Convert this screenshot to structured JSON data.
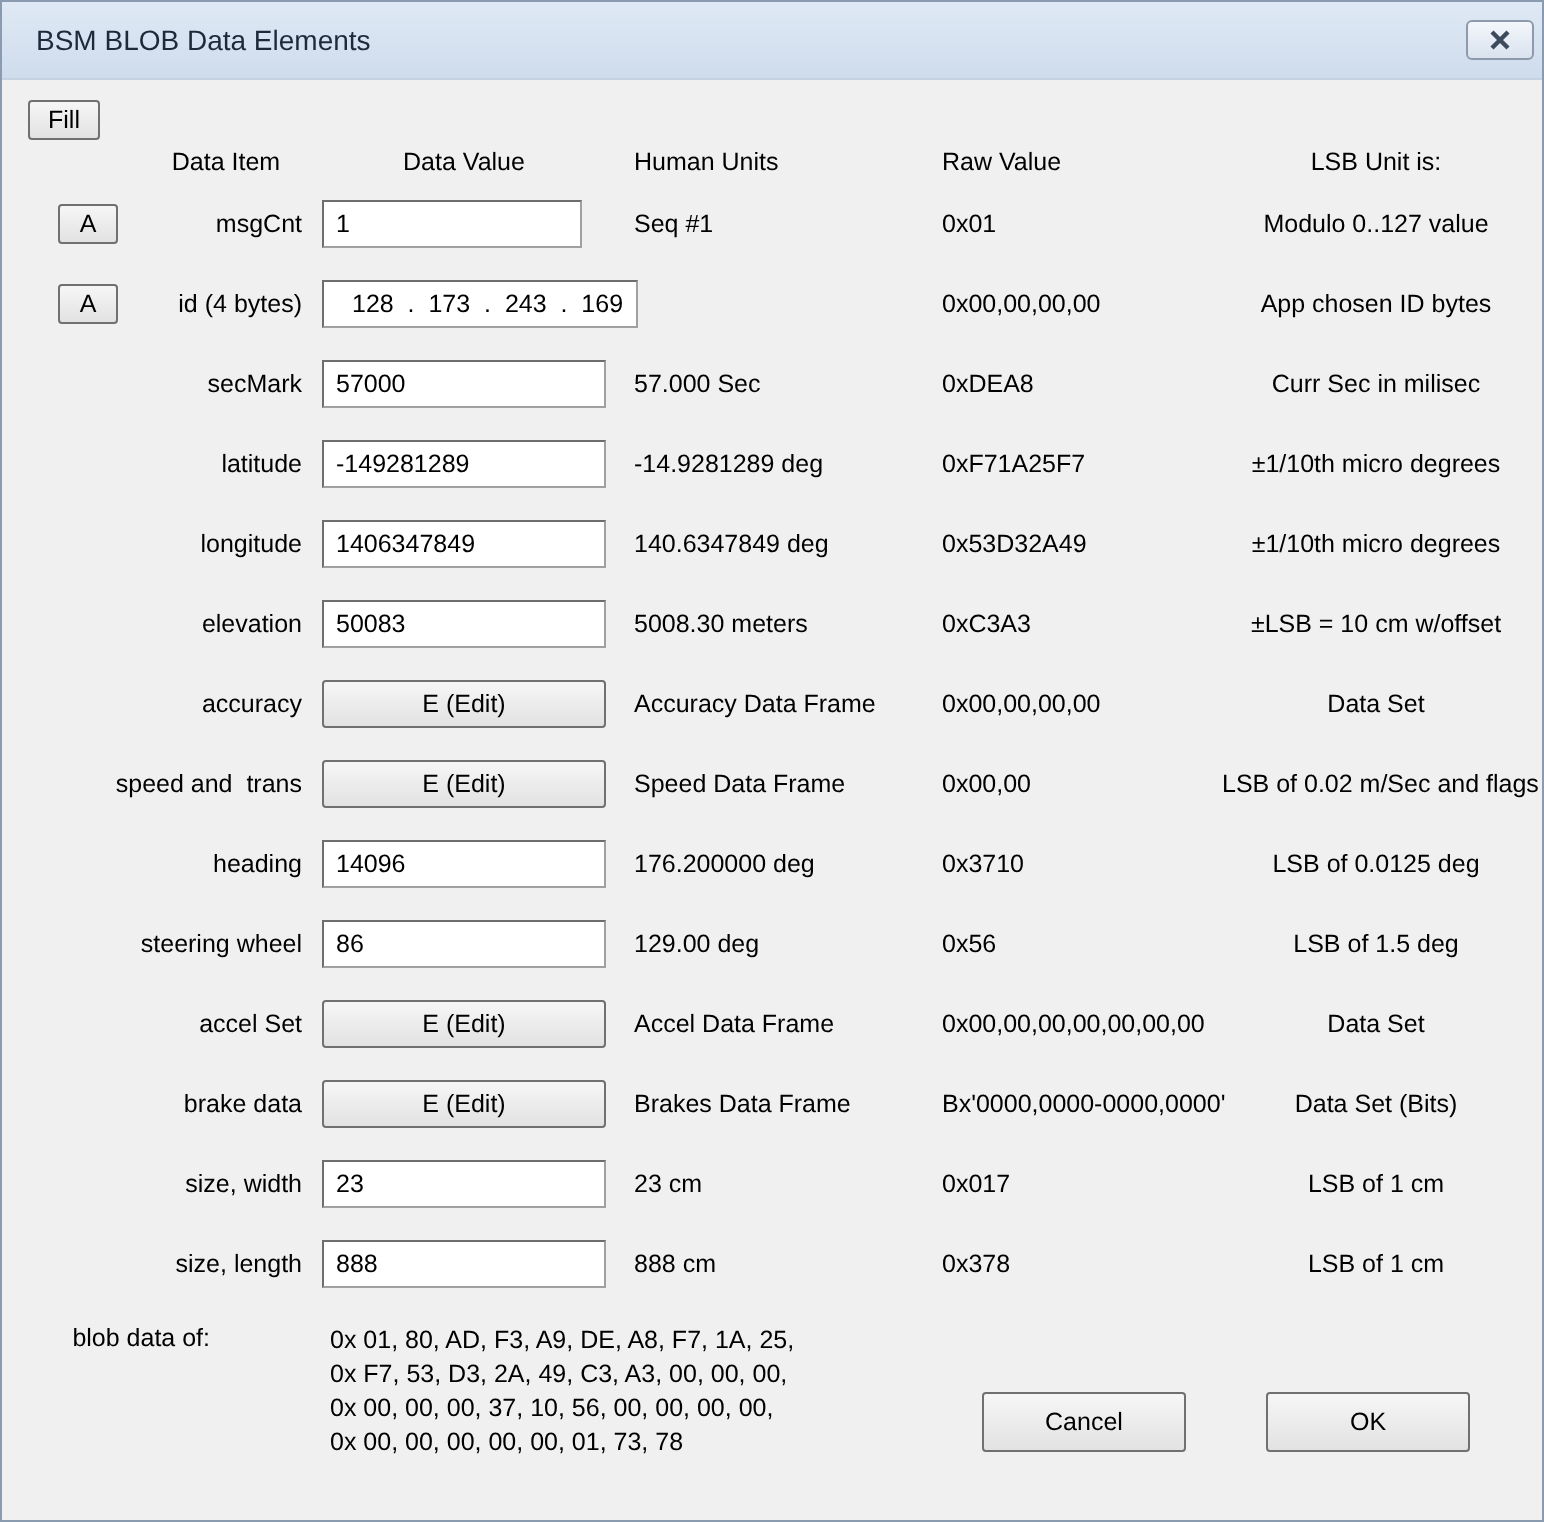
{
  "window": {
    "title": "BSM BLOB Data Elements"
  },
  "fill_button": "Fill",
  "columns": [
    "Data Item",
    "Data Value",
    "Human Units",
    "Raw Value",
    "LSB Unit is:"
  ],
  "rows": [
    {
      "kind": "field",
      "assist": "A",
      "label": "msgCnt",
      "value": "1",
      "human": "Seq #1",
      "raw": "0x01",
      "lsb": "Modulo 0..127 value"
    },
    {
      "kind": "address",
      "assist": "A",
      "label": "id (4 bytes)",
      "value": "128  .  173  .  243  .  169",
      "raw": "0x00,00,00,00",
      "lsb": "App chosen ID bytes"
    },
    {
      "kind": "field",
      "label": "secMark",
      "value": "57000",
      "human": "57.000 Sec",
      "raw": "0xDEA8",
      "lsb": "Curr Sec in milisec"
    },
    {
      "kind": "field",
      "label": "latitude",
      "value": "-149281289",
      "human": "-14.9281289 deg",
      "raw": "0xF71A25F7",
      "lsb": "±1/10th micro degrees"
    },
    {
      "kind": "field",
      "label": "longitude",
      "value": "1406347849",
      "human": "140.6347849 deg",
      "raw": "0x53D32A49",
      "lsb": "±1/10th micro degrees"
    },
    {
      "kind": "field",
      "label": "elevation",
      "value": "50083",
      "human": "5008.30 meters",
      "raw": "0xC3A3",
      "lsb": "±LSB = 10 cm w/offset"
    },
    {
      "kind": "edit",
      "label": "accuracy",
      "value": "E (Edit)",
      "human": "Accuracy Data Frame",
      "raw": "0x00,00,00,00",
      "lsb": "Data Set"
    },
    {
      "kind": "edit",
      "label": "speed and  trans",
      "value": "E (Edit)",
      "human": "Speed Data Frame",
      "raw": "0x00,00",
      "lsb": "LSB of 0.02 m/Sec and flags"
    },
    {
      "kind": "field",
      "label": "heading",
      "value": "14096",
      "human": "176.200000 deg",
      "raw": "0x3710",
      "lsb": "LSB of 0.0125 deg"
    },
    {
      "kind": "field",
      "label": "steering wheel",
      "value": "86",
      "human": "129.00 deg",
      "raw": "0x56",
      "lsb": "LSB of 1.5 deg"
    },
    {
      "kind": "edit",
      "label": "accel Set",
      "value": "E (Edit)",
      "human": "Accel Data Frame",
      "raw": "0x00,00,00,00,00,00,00",
      "lsb": "Data Set"
    },
    {
      "kind": "edit",
      "label": "brake data",
      "value": "E (Edit)",
      "human": "Brakes Data Frame",
      "raw": "Bx'0000,0000-0000,0000'",
      "lsb": "Data Set (Bits)"
    },
    {
      "kind": "field",
      "label": "size, width",
      "value": "23",
      "human": "23 cm",
      "raw": "0x017",
      "lsb": "LSB of 1 cm"
    },
    {
      "kind": "field",
      "label": "size, length",
      "value": "888",
      "human": "888 cm",
      "raw": "0x378",
      "lsb": "LSB of 1 cm"
    }
  ],
  "blob": {
    "label": "blob data of:",
    "lines": [
      "0x 01, 80, AD, F3, A9, DE, A8, F7, 1A, 25,",
      "0x F7, 53, D3, 2A, 49, C3, A3, 00, 00, 00,",
      "0x 00, 00, 00, 37, 10, 56, 00, 00, 00, 00,",
      "0x 00, 00, 00, 00, 00, 01, 73, 78"
    ]
  },
  "buttons": [
    "Cancel",
    "OK"
  ]
}
